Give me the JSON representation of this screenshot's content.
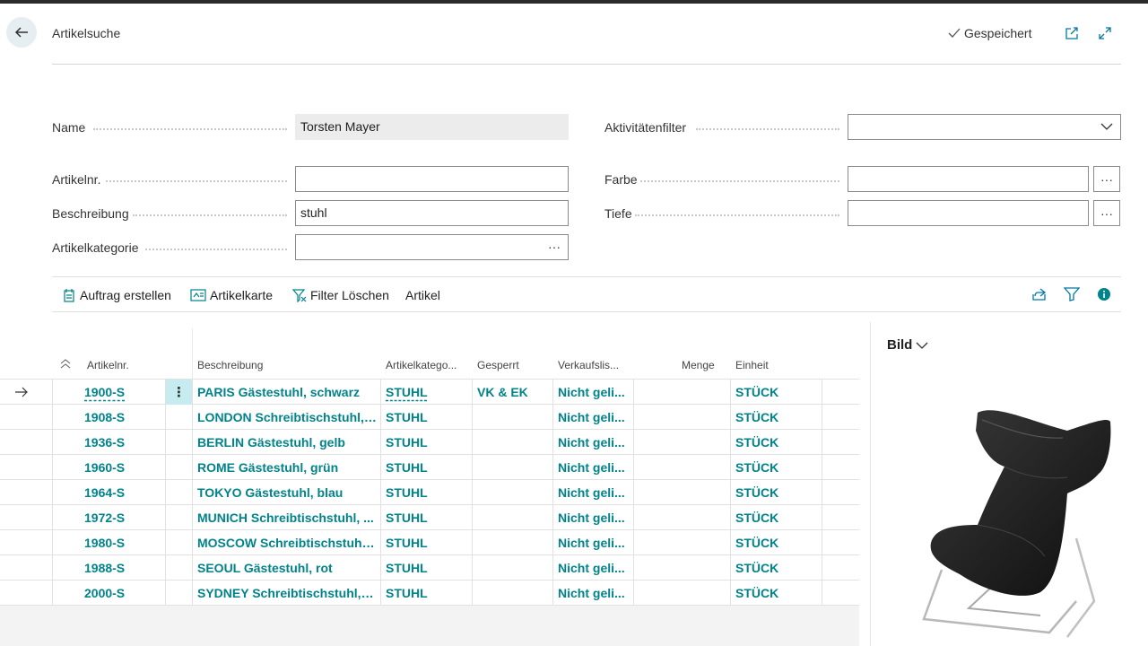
{
  "header": {
    "title": "Artikelsuche",
    "saved_label": "Gespeichert"
  },
  "fields": {
    "name": {
      "label": "Name",
      "value": "Torsten Mayer"
    },
    "artikelnr": {
      "label": "Artikelnr.",
      "value": ""
    },
    "beschreibung": {
      "label": "Beschreibung",
      "value": "stuhl"
    },
    "artikelkategorie": {
      "label": "Artikelkategorie",
      "value": ""
    },
    "aktivitaetenfilter": {
      "label": "Aktivitätenfilter",
      "value": ""
    },
    "farbe": {
      "label": "Farbe",
      "value": ""
    },
    "tiefe": {
      "label": "Tiefe",
      "value": ""
    }
  },
  "actions": {
    "auftrag": "Auftrag erstellen",
    "artikelkarte": "Artikelkarte",
    "filter_loeschen": "Filter Löschen",
    "artikel": "Artikel"
  },
  "table": {
    "columns": [
      "Artikelnr.",
      "Beschreibung",
      "Artikelkatego...",
      "Gesperrt",
      "Verkaufslis...",
      "Menge",
      "Einheit"
    ],
    "rows": [
      {
        "nr": "1900-S",
        "desc": "PARIS Gästestuhl, schwarz",
        "cat": "STUHL",
        "gesperrt": "VK & EK",
        "vk": "Nicht geli...",
        "menge": "",
        "einheit": "STÜCK"
      },
      {
        "nr": "1908-S",
        "desc": "LONDON Schreibtischstuhl, ...",
        "cat": "STUHL",
        "gesperrt": "",
        "vk": "Nicht geli...",
        "menge": "",
        "einheit": "STÜCK"
      },
      {
        "nr": "1936-S",
        "desc": "BERLIN Gästestuhl, gelb",
        "cat": "STUHL",
        "gesperrt": "",
        "vk": "Nicht geli...",
        "menge": "",
        "einheit": "STÜCK"
      },
      {
        "nr": "1960-S",
        "desc": "ROME Gästestuhl, grün",
        "cat": "STUHL",
        "gesperrt": "",
        "vk": "Nicht geli...",
        "menge": "",
        "einheit": "STÜCK"
      },
      {
        "nr": "1964-S",
        "desc": "TOKYO Gästestuhl, blau",
        "cat": "STUHL",
        "gesperrt": "",
        "vk": "Nicht geli...",
        "menge": "",
        "einheit": "STÜCK"
      },
      {
        "nr": "1972-S",
        "desc": "MUNICH Schreibtischstuhl, ...",
        "cat": "STUHL",
        "gesperrt": "",
        "vk": "Nicht geli...",
        "menge": "",
        "einheit": "STÜCK"
      },
      {
        "nr": "1980-S",
        "desc": "MOSCOW Schreibtischstuhl,...",
        "cat": "STUHL",
        "gesperrt": "",
        "vk": "Nicht geli...",
        "menge": "",
        "einheit": "STÜCK"
      },
      {
        "nr": "1988-S",
        "desc": "SEOUL Gästestuhl, rot",
        "cat": "STUHL",
        "gesperrt": "",
        "vk": "Nicht geli...",
        "menge": "",
        "einheit": "STÜCK"
      },
      {
        "nr": "2000-S",
        "desc": "SYDNEY Schreibtischstuhl, g...",
        "cat": "STUHL",
        "gesperrt": "",
        "vk": "Nicht geli...",
        "menge": "",
        "einheit": "STÜCK"
      }
    ]
  },
  "factbox": {
    "title": "Bild"
  },
  "colors": {
    "accent": "#00838a",
    "selected_cell": "#c6ecef",
    "back_button": "#e6eef2"
  },
  "icons": [
    "back-arrow-icon",
    "checkmark-icon",
    "open-new-window-icon",
    "expand-icon",
    "chevron-down-icon",
    "ellipsis-icon",
    "new-order-icon",
    "item-card-icon",
    "clear-filter-icon",
    "share-icon",
    "filter-icon",
    "info-icon",
    "sort-ascending-icon",
    "row-arrow-icon",
    "row-menu-icon"
  ]
}
